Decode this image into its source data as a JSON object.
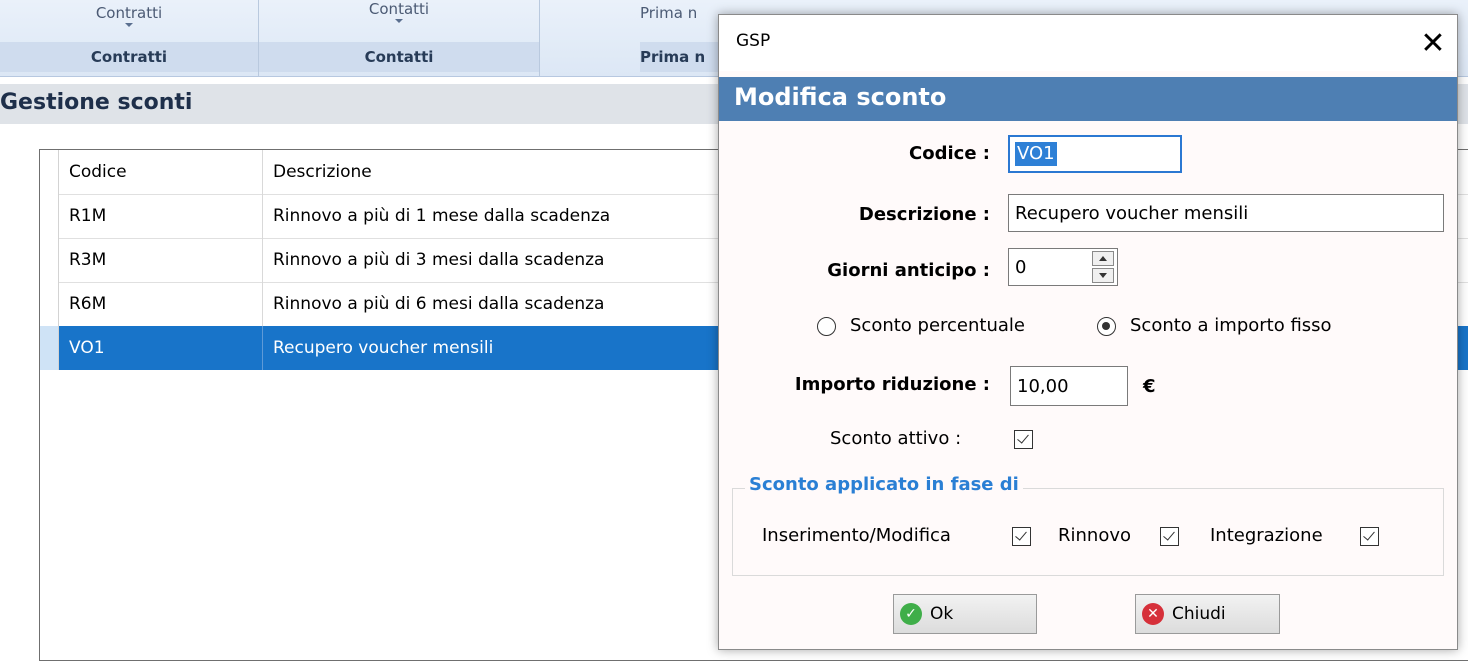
{
  "ribbon": {
    "groups": [
      {
        "button": "Contratti",
        "caption": "Contratti"
      },
      {
        "button": "Contatti",
        "caption": "Contatti"
      },
      {
        "button": "Prima n",
        "caption": "Prima n"
      }
    ]
  },
  "page": {
    "title": "Gestione sconti"
  },
  "grid": {
    "columns": [
      "Codice",
      "Descrizione"
    ],
    "rows": [
      {
        "code": "R1M",
        "desc": "Rinnovo a più di 1 mese dalla scadenza"
      },
      {
        "code": "R3M",
        "desc": "Rinnovo a più di 3 mesi dalla scadenza"
      },
      {
        "code": "R6M",
        "desc": "Rinnovo a più di 6 mesi dalla scadenza"
      },
      {
        "code": "VO1",
        "desc": "Recupero voucher mensili",
        "selected": true
      }
    ]
  },
  "dialog": {
    "window_title": "GSP",
    "close_glyph": "✕",
    "header": "Modifica sconto",
    "codice": {
      "label": "Codice :",
      "value": "VO1"
    },
    "descrizione": {
      "label": "Descrizione :",
      "value": "Recupero voucher mensili"
    },
    "giorni": {
      "label": "Giorni anticipo :",
      "value": "0"
    },
    "tipo": {
      "percentuale": {
        "label": "Sconto percentuale",
        "selected": false
      },
      "fisso": {
        "label": "Sconto a importo fisso",
        "selected": true
      }
    },
    "importo": {
      "label": "Importo riduzione :",
      "value": "10,00",
      "currency": "€"
    },
    "attivo": {
      "label": "Sconto attivo :",
      "checked": true
    },
    "fase": {
      "legend": "Sconto applicato in fase di",
      "inserimento": {
        "label": "Inserimento/Modifica",
        "checked": true
      },
      "rinnovo": {
        "label": "Rinnovo",
        "checked": true
      },
      "integrazione": {
        "label": "Integrazione",
        "checked": true
      }
    },
    "ok_label": "Ok",
    "close_label": "Chiudi"
  },
  "colors": {
    "accent": "#1874c9",
    "dialog_band": "#4e7fb3",
    "legend": "#2a7fd4"
  },
  "icons": {
    "ok": "ok-check-icon",
    "close": "close-x-icon"
  }
}
